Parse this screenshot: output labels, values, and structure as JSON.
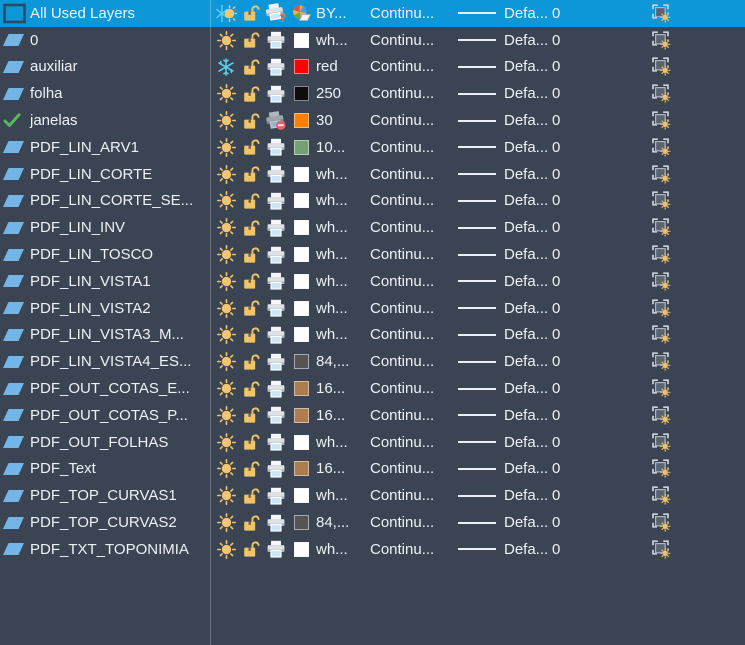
{
  "panel": {
    "description": "AutoCAD layer list (dark theme)",
    "colors": {
      "background": "#3a4453",
      "selection": "#0d97d8",
      "text": "#eef2f6",
      "divider": "rgba(255,255,255,0.26)",
      "sun": "#f3c572",
      "snowflake": "#5bcde6",
      "padlock": "#f0c467",
      "layer_parallelogram": "#73b5e6",
      "current_check": "#57b75c"
    }
  },
  "rows": [
    {
      "name": "All Used Layers",
      "selected": true,
      "status_icon": "filter-box-icon",
      "on_icon": "sun-snowflake-mixed-icon",
      "lock_icon": "unlocked-padlock-icon",
      "plot_icon": "printer-question-icon",
      "color": {
        "label": "BY...",
        "hex": "varies"
      },
      "linetype": "Continu...",
      "lineweight": "Defa...",
      "transparency": "0",
      "vp_icon": "vp-freeze-icon"
    },
    {
      "name": "0",
      "selected": false,
      "status_icon": "layer-parallelogram-icon",
      "on_icon": "sun-icon",
      "lock_icon": "unlocked-padlock-icon",
      "plot_icon": "printer-icon",
      "color": {
        "label": "wh...",
        "hex": "#ffffff"
      },
      "linetype": "Continu...",
      "lineweight": "Defa...",
      "transparency": "0",
      "vp_icon": "vp-freeze-icon"
    },
    {
      "name": "auxiliar",
      "selected": false,
      "status_icon": "layer-parallelogram-icon",
      "on_icon": "snowflake-icon",
      "lock_icon": "unlocked-padlock-icon",
      "plot_icon": "printer-icon",
      "color": {
        "label": "red",
        "hex": "#ff0000"
      },
      "linetype": "Continu...",
      "lineweight": "Defa...",
      "transparency": "0",
      "vp_icon": "vp-freeze-icon"
    },
    {
      "name": "folha",
      "selected": false,
      "status_icon": "layer-parallelogram-icon",
      "on_icon": "sun-icon",
      "lock_icon": "unlocked-padlock-icon",
      "plot_icon": "printer-icon",
      "color": {
        "label": "250",
        "hex": "#0d0d0d"
      },
      "linetype": "Continu...",
      "lineweight": "Defa...",
      "transparency": "0",
      "vp_icon": "vp-freeze-icon"
    },
    {
      "name": "janelas",
      "selected": false,
      "status_icon": "current-layer-check-icon",
      "on_icon": "sun-icon",
      "lock_icon": "unlocked-padlock-icon",
      "plot_icon": "printer-no-plot-icon",
      "color": {
        "label": "30",
        "hex": "#ff7f00"
      },
      "linetype": "Continu...",
      "lineweight": "Defa...",
      "transparency": "0",
      "vp_icon": "vp-freeze-icon"
    },
    {
      "name": "PDF_LIN_ARV1",
      "selected": false,
      "status_icon": "layer-parallelogram-icon",
      "on_icon": "sun-icon",
      "lock_icon": "unlocked-padlock-icon",
      "plot_icon": "printer-icon",
      "color": {
        "label": "10...",
        "hex": "#74a074"
      },
      "linetype": "Continu...",
      "lineweight": "Defa...",
      "transparency": "0",
      "vp_icon": "vp-freeze-icon"
    },
    {
      "name": "PDF_LIN_CORTE",
      "selected": false,
      "status_icon": "layer-parallelogram-icon",
      "on_icon": "sun-icon",
      "lock_icon": "unlocked-padlock-icon",
      "plot_icon": "printer-icon",
      "color": {
        "label": "wh...",
        "hex": "#ffffff"
      },
      "linetype": "Continu...",
      "lineweight": "Defa...",
      "transparency": "0",
      "vp_icon": "vp-freeze-icon"
    },
    {
      "name": "PDF_LIN_CORTE_SE...",
      "selected": false,
      "status_icon": "layer-parallelogram-icon",
      "on_icon": "sun-icon",
      "lock_icon": "unlocked-padlock-icon",
      "plot_icon": "printer-icon",
      "color": {
        "label": "wh...",
        "hex": "#ffffff"
      },
      "linetype": "Continu...",
      "lineweight": "Defa...",
      "transparency": "0",
      "vp_icon": "vp-freeze-icon"
    },
    {
      "name": "PDF_LIN_INV",
      "selected": false,
      "status_icon": "layer-parallelogram-icon",
      "on_icon": "sun-icon",
      "lock_icon": "unlocked-padlock-icon",
      "plot_icon": "printer-icon",
      "color": {
        "label": "wh...",
        "hex": "#ffffff"
      },
      "linetype": "Continu...",
      "lineweight": "Defa...",
      "transparency": "0",
      "vp_icon": "vp-freeze-icon"
    },
    {
      "name": "PDF_LIN_TOSCO",
      "selected": false,
      "status_icon": "layer-parallelogram-icon",
      "on_icon": "sun-icon",
      "lock_icon": "unlocked-padlock-icon",
      "plot_icon": "printer-icon",
      "color": {
        "label": "wh...",
        "hex": "#ffffff"
      },
      "linetype": "Continu...",
      "lineweight": "Defa...",
      "transparency": "0",
      "vp_icon": "vp-freeze-icon"
    },
    {
      "name": "PDF_LIN_VISTA1",
      "selected": false,
      "status_icon": "layer-parallelogram-icon",
      "on_icon": "sun-icon",
      "lock_icon": "unlocked-padlock-icon",
      "plot_icon": "printer-icon",
      "color": {
        "label": "wh...",
        "hex": "#ffffff"
      },
      "linetype": "Continu...",
      "lineweight": "Defa...",
      "transparency": "0",
      "vp_icon": "vp-freeze-icon"
    },
    {
      "name": "PDF_LIN_VISTA2",
      "selected": false,
      "status_icon": "layer-parallelogram-icon",
      "on_icon": "sun-icon",
      "lock_icon": "unlocked-padlock-icon",
      "plot_icon": "printer-icon",
      "color": {
        "label": "wh...",
        "hex": "#ffffff"
      },
      "linetype": "Continu...",
      "lineweight": "Defa...",
      "transparency": "0",
      "vp_icon": "vp-freeze-icon"
    },
    {
      "name": "PDF_LIN_VISTA3_M...",
      "selected": false,
      "status_icon": "layer-parallelogram-icon",
      "on_icon": "sun-icon",
      "lock_icon": "unlocked-padlock-icon",
      "plot_icon": "printer-icon",
      "color": {
        "label": "wh...",
        "hex": "#ffffff"
      },
      "linetype": "Continu...",
      "lineweight": "Defa...",
      "transparency": "0",
      "vp_icon": "vp-freeze-icon"
    },
    {
      "name": "PDF_LIN_VISTA4_ES...",
      "selected": false,
      "status_icon": "layer-parallelogram-icon",
      "on_icon": "sun-icon",
      "lock_icon": "unlocked-padlock-icon",
      "plot_icon": "printer-icon",
      "color": {
        "label": "84,...",
        "hex": "#545454"
      },
      "linetype": "Continu...",
      "lineweight": "Defa...",
      "transparency": "0",
      "vp_icon": "vp-freeze-icon"
    },
    {
      "name": "PDF_OUT_COTAS_E...",
      "selected": false,
      "status_icon": "layer-parallelogram-icon",
      "on_icon": "sun-icon",
      "lock_icon": "unlocked-padlock-icon",
      "plot_icon": "printer-icon",
      "color": {
        "label": "16...",
        "hex": "#ad7d4e"
      },
      "linetype": "Continu...",
      "lineweight": "Defa...",
      "transparency": "0",
      "vp_icon": "vp-freeze-icon"
    },
    {
      "name": "PDF_OUT_COTAS_P...",
      "selected": false,
      "status_icon": "layer-parallelogram-icon",
      "on_icon": "sun-icon",
      "lock_icon": "unlocked-padlock-icon",
      "plot_icon": "printer-icon",
      "color": {
        "label": "16...",
        "hex": "#ad7d4e"
      },
      "linetype": "Continu...",
      "lineweight": "Defa...",
      "transparency": "0",
      "vp_icon": "vp-freeze-icon"
    },
    {
      "name": "PDF_OUT_FOLHAS",
      "selected": false,
      "status_icon": "layer-parallelogram-icon",
      "on_icon": "sun-icon",
      "lock_icon": "unlocked-padlock-icon",
      "plot_icon": "printer-icon",
      "color": {
        "label": "wh...",
        "hex": "#ffffff"
      },
      "linetype": "Continu...",
      "lineweight": "Defa...",
      "transparency": "0",
      "vp_icon": "vp-freeze-icon"
    },
    {
      "name": "PDF_Text",
      "selected": false,
      "status_icon": "layer-parallelogram-icon",
      "on_icon": "sun-icon",
      "lock_icon": "unlocked-padlock-icon",
      "plot_icon": "printer-icon",
      "color": {
        "label": "16...",
        "hex": "#ad7d4e"
      },
      "linetype": "Continu...",
      "lineweight": "Defa...",
      "transparency": "0",
      "vp_icon": "vp-freeze-icon"
    },
    {
      "name": "PDF_TOP_CURVAS1",
      "selected": false,
      "status_icon": "layer-parallelogram-icon",
      "on_icon": "sun-icon",
      "lock_icon": "unlocked-padlock-icon",
      "plot_icon": "printer-icon",
      "color": {
        "label": "wh...",
        "hex": "#ffffff"
      },
      "linetype": "Continu...",
      "lineweight": "Defa...",
      "transparency": "0",
      "vp_icon": "vp-freeze-icon"
    },
    {
      "name": "PDF_TOP_CURVAS2",
      "selected": false,
      "status_icon": "layer-parallelogram-icon",
      "on_icon": "sun-icon",
      "lock_icon": "unlocked-padlock-icon",
      "plot_icon": "printer-icon",
      "color": {
        "label": "84,...",
        "hex": "#545454"
      },
      "linetype": "Continu...",
      "lineweight": "Defa...",
      "transparency": "0",
      "vp_icon": "vp-freeze-icon"
    },
    {
      "name": "PDF_TXT_TOPONIMIA",
      "selected": false,
      "status_icon": "layer-parallelogram-icon",
      "on_icon": "sun-icon",
      "lock_icon": "unlocked-padlock-icon",
      "plot_icon": "printer-icon",
      "color": {
        "label": "wh...",
        "hex": "#ffffff"
      },
      "linetype": "Continu...",
      "lineweight": "Defa...",
      "transparency": "0",
      "vp_icon": "vp-freeze-icon"
    }
  ]
}
